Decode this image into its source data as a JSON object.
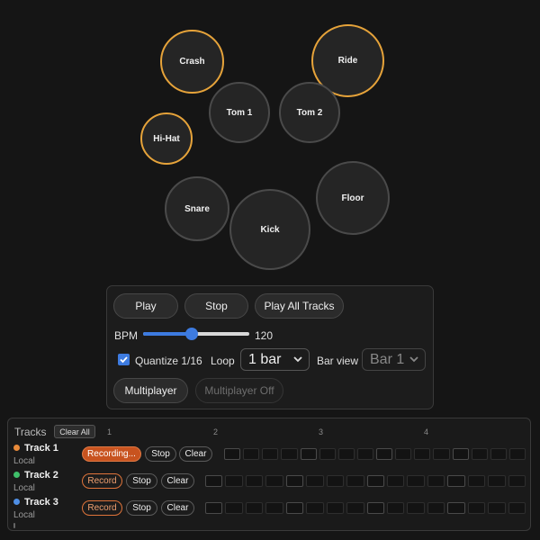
{
  "pads": [
    {
      "id": "crash",
      "label": "Crash",
      "active": true
    },
    {
      "id": "ride",
      "label": "Ride",
      "active": true
    },
    {
      "id": "tom1",
      "label": "Tom 1",
      "active": false
    },
    {
      "id": "tom2",
      "label": "Tom 2",
      "active": false
    },
    {
      "id": "hihat",
      "label": "Hi-Hat",
      "active": true
    },
    {
      "id": "snare",
      "label": "Snare",
      "active": false
    },
    {
      "id": "kick",
      "label": "Kick",
      "active": false
    },
    {
      "id": "floor",
      "label": "Floor",
      "active": false
    }
  ],
  "controls": {
    "play_label": "Play",
    "stop_label": "Stop",
    "play_all_label": "Play All Tracks",
    "bpm_label": "BPM",
    "bpm_value": "120",
    "bpm_fraction": 0.45,
    "quantize_label": "Quantize 1/16",
    "quantize_checked": true,
    "loop_label": "Loop",
    "loop_value": "1 bar",
    "bar_view_label": "Bar view",
    "bar_view_value": "Bar 1",
    "multiplayer_label": "Multiplayer",
    "multiplayer_off_label": "Multiplayer Off"
  },
  "colors": {
    "accent": "#e6a33a",
    "recording": "#c8531f",
    "checkbox": "#3d7be0"
  },
  "tracks_panel": {
    "title": "Tracks",
    "clear_all_label": "Clear All",
    "bar_numbers": [
      "1",
      "2",
      "3",
      "4"
    ],
    "steps_per_track": 16,
    "tracks": [
      {
        "name": "Track 1",
        "sub": "Local",
        "color": "#e88a3a",
        "record_label": "Recording...",
        "recording": true,
        "stop_label": "Stop",
        "clear_label": "Clear"
      },
      {
        "name": "Track 2",
        "sub": "Local",
        "color": "#3fbf6a",
        "record_label": "Record",
        "recording": false,
        "stop_label": "Stop",
        "clear_label": "Clear"
      },
      {
        "name": "Track 3",
        "sub": "Local",
        "color": "#4f8fe6",
        "record_label": "Record",
        "recording": false,
        "stop_label": "Stop",
        "clear_label": "Clear"
      }
    ]
  }
}
